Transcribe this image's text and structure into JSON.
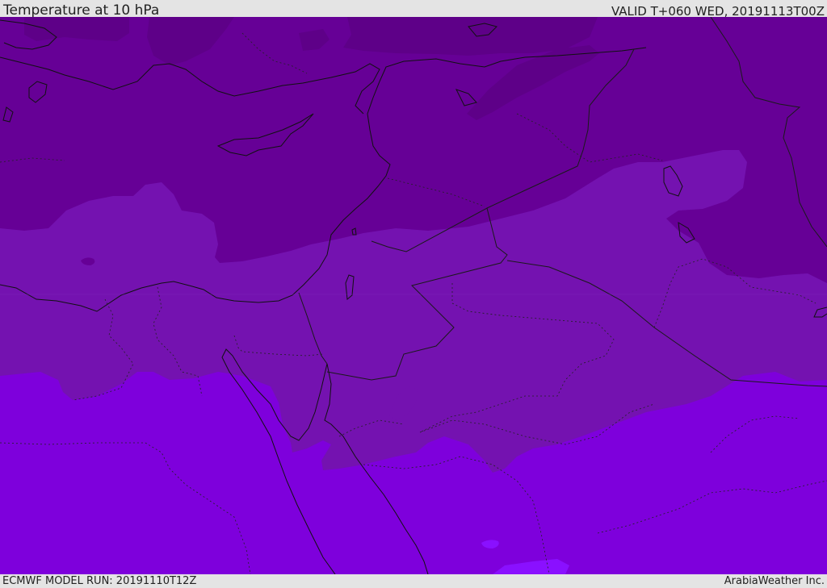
{
  "header": {
    "title": "Temperature at 10 hPa",
    "valid": "VALID T+060 WED, 20191113T00Z"
  },
  "footer": {
    "model_run": "ECMWF MODEL RUN: 20191110T12Z",
    "credit": "ArabiaWeather Inc."
  },
  "map": {
    "region": "Eastern Mediterranean / Middle East",
    "colors": {
      "band_darkest": "#5e0088",
      "band_dark": "#660096",
      "band_mid": "#7412b0",
      "band_light": "#7e00dc",
      "band_brightest": "#8a10ff",
      "coastline": "#111111",
      "border": "#1a1a1a"
    }
  }
}
